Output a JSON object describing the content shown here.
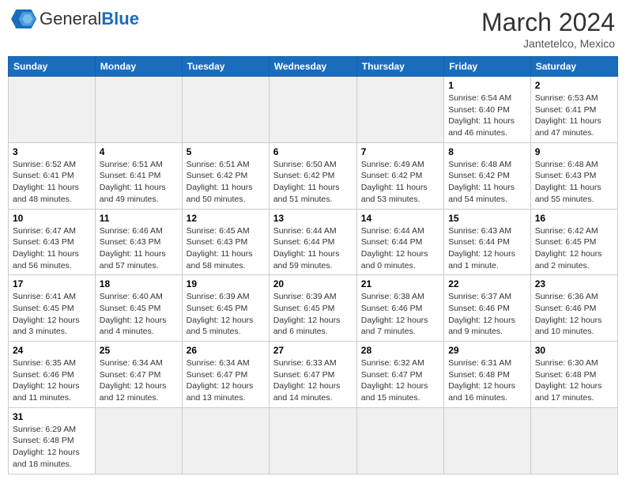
{
  "header": {
    "logo_general": "General",
    "logo_blue": "Blue",
    "month": "March 2024",
    "location": "Jantetelco, Mexico"
  },
  "days_of_week": [
    "Sunday",
    "Monday",
    "Tuesday",
    "Wednesday",
    "Thursday",
    "Friday",
    "Saturday"
  ],
  "weeks": [
    [
      {
        "day": "",
        "info": ""
      },
      {
        "day": "",
        "info": ""
      },
      {
        "day": "",
        "info": ""
      },
      {
        "day": "",
        "info": ""
      },
      {
        "day": "",
        "info": ""
      },
      {
        "day": "1",
        "info": "Sunrise: 6:54 AM\nSunset: 6:40 PM\nDaylight: 11 hours and 46 minutes."
      },
      {
        "day": "2",
        "info": "Sunrise: 6:53 AM\nSunset: 6:41 PM\nDaylight: 11 hours and 47 minutes."
      }
    ],
    [
      {
        "day": "3",
        "info": "Sunrise: 6:52 AM\nSunset: 6:41 PM\nDaylight: 11 hours and 48 minutes."
      },
      {
        "day": "4",
        "info": "Sunrise: 6:51 AM\nSunset: 6:41 PM\nDaylight: 11 hours and 49 minutes."
      },
      {
        "day": "5",
        "info": "Sunrise: 6:51 AM\nSunset: 6:42 PM\nDaylight: 11 hours and 50 minutes."
      },
      {
        "day": "6",
        "info": "Sunrise: 6:50 AM\nSunset: 6:42 PM\nDaylight: 11 hours and 51 minutes."
      },
      {
        "day": "7",
        "info": "Sunrise: 6:49 AM\nSunset: 6:42 PM\nDaylight: 11 hours and 53 minutes."
      },
      {
        "day": "8",
        "info": "Sunrise: 6:48 AM\nSunset: 6:42 PM\nDaylight: 11 hours and 54 minutes."
      },
      {
        "day": "9",
        "info": "Sunrise: 6:48 AM\nSunset: 6:43 PM\nDaylight: 11 hours and 55 minutes."
      }
    ],
    [
      {
        "day": "10",
        "info": "Sunrise: 6:47 AM\nSunset: 6:43 PM\nDaylight: 11 hours and 56 minutes."
      },
      {
        "day": "11",
        "info": "Sunrise: 6:46 AM\nSunset: 6:43 PM\nDaylight: 11 hours and 57 minutes."
      },
      {
        "day": "12",
        "info": "Sunrise: 6:45 AM\nSunset: 6:43 PM\nDaylight: 11 hours and 58 minutes."
      },
      {
        "day": "13",
        "info": "Sunrise: 6:44 AM\nSunset: 6:44 PM\nDaylight: 11 hours and 59 minutes."
      },
      {
        "day": "14",
        "info": "Sunrise: 6:44 AM\nSunset: 6:44 PM\nDaylight: 12 hours and 0 minutes."
      },
      {
        "day": "15",
        "info": "Sunrise: 6:43 AM\nSunset: 6:44 PM\nDaylight: 12 hours and 1 minute."
      },
      {
        "day": "16",
        "info": "Sunrise: 6:42 AM\nSunset: 6:45 PM\nDaylight: 12 hours and 2 minutes."
      }
    ],
    [
      {
        "day": "17",
        "info": "Sunrise: 6:41 AM\nSunset: 6:45 PM\nDaylight: 12 hours and 3 minutes."
      },
      {
        "day": "18",
        "info": "Sunrise: 6:40 AM\nSunset: 6:45 PM\nDaylight: 12 hours and 4 minutes."
      },
      {
        "day": "19",
        "info": "Sunrise: 6:39 AM\nSunset: 6:45 PM\nDaylight: 12 hours and 5 minutes."
      },
      {
        "day": "20",
        "info": "Sunrise: 6:39 AM\nSunset: 6:45 PM\nDaylight: 12 hours and 6 minutes."
      },
      {
        "day": "21",
        "info": "Sunrise: 6:38 AM\nSunset: 6:46 PM\nDaylight: 12 hours and 7 minutes."
      },
      {
        "day": "22",
        "info": "Sunrise: 6:37 AM\nSunset: 6:46 PM\nDaylight: 12 hours and 9 minutes."
      },
      {
        "day": "23",
        "info": "Sunrise: 6:36 AM\nSunset: 6:46 PM\nDaylight: 12 hours and 10 minutes."
      }
    ],
    [
      {
        "day": "24",
        "info": "Sunrise: 6:35 AM\nSunset: 6:46 PM\nDaylight: 12 hours and 11 minutes."
      },
      {
        "day": "25",
        "info": "Sunrise: 6:34 AM\nSunset: 6:47 PM\nDaylight: 12 hours and 12 minutes."
      },
      {
        "day": "26",
        "info": "Sunrise: 6:34 AM\nSunset: 6:47 PM\nDaylight: 12 hours and 13 minutes."
      },
      {
        "day": "27",
        "info": "Sunrise: 6:33 AM\nSunset: 6:47 PM\nDaylight: 12 hours and 14 minutes."
      },
      {
        "day": "28",
        "info": "Sunrise: 6:32 AM\nSunset: 6:47 PM\nDaylight: 12 hours and 15 minutes."
      },
      {
        "day": "29",
        "info": "Sunrise: 6:31 AM\nSunset: 6:48 PM\nDaylight: 12 hours and 16 minutes."
      },
      {
        "day": "30",
        "info": "Sunrise: 6:30 AM\nSunset: 6:48 PM\nDaylight: 12 hours and 17 minutes."
      }
    ],
    [
      {
        "day": "31",
        "info": "Sunrise: 6:29 AM\nSunset: 6:48 PM\nDaylight: 12 hours and 18 minutes."
      },
      {
        "day": "",
        "info": ""
      },
      {
        "day": "",
        "info": ""
      },
      {
        "day": "",
        "info": ""
      },
      {
        "day": "",
        "info": ""
      },
      {
        "day": "",
        "info": ""
      },
      {
        "day": "",
        "info": ""
      }
    ]
  ]
}
